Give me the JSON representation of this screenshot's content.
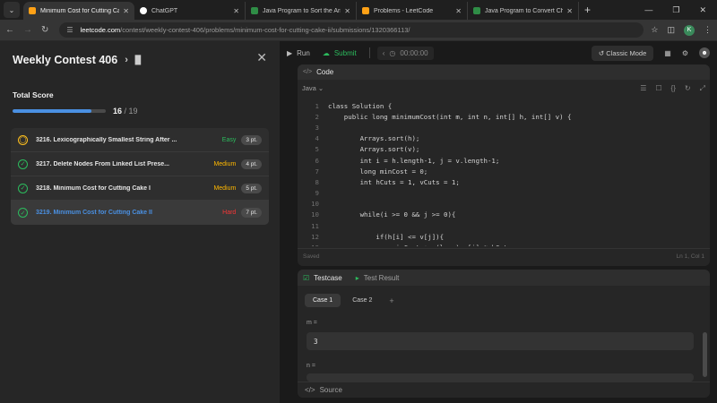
{
  "browser": {
    "tabs": [
      {
        "title": "Minimum Cost for Cutting Cake",
        "active": true,
        "fav_color": "#ffa116"
      },
      {
        "title": "ChatGPT",
        "active": false,
        "fav_color": "#ffffff"
      },
      {
        "title": "Java Program to Sort the Array",
        "active": false,
        "fav_color": "#2f8d46"
      },
      {
        "title": "Problems - LeetCode",
        "active": false,
        "fav_color": "#ffa116"
      },
      {
        "title": "Java Program to Convert Char",
        "active": false,
        "fav_color": "#2f8d46"
      }
    ],
    "url_domain": "leetcode.com",
    "url_path": "/contest/weekly-contest-406/problems/minimum-cost-for-cutting-cake-ii/submissions/1320366113/",
    "avatar_letter": "K"
  },
  "contest": {
    "title": "Weekly Contest 406",
    "score_label": "Total Score",
    "score": "16",
    "score_total": "/ 19",
    "progress": 0.842,
    "problems": [
      {
        "title": "3216. Lexicographically Smallest String After ...",
        "difficulty": "Easy",
        "points": "3 pt.",
        "status": "pending"
      },
      {
        "title": "3217. Delete Nodes From Linked List Prese...",
        "difficulty": "Medium",
        "points": "4 pt.",
        "status": "done"
      },
      {
        "title": "3218. Minimum Cost for Cutting Cake I",
        "difficulty": "Medium",
        "points": "5 pt.",
        "status": "done"
      },
      {
        "title": "3219. Minimum Cost for Cutting Cake II",
        "difficulty": "Hard",
        "points": "7 pt.",
        "status": "done"
      }
    ]
  },
  "toolbar": {
    "run": "Run",
    "submit": "Submit",
    "timer": "00:00:00",
    "classic_mode": "Classic Mode"
  },
  "code_panel": {
    "title": "Code",
    "language": "Java",
    "saved": "Saved",
    "cursor": "Ln 1, Col 1",
    "lines": [
      {
        "n": "1",
        "text": "class Solution {"
      },
      {
        "n": "2",
        "text": "    public long minimumCost(int m, int n, int[] h, int[] v) {"
      },
      {
        "n": "3",
        "text": ""
      },
      {
        "n": "4",
        "text": "        Arrays.sort(h);"
      },
      {
        "n": "5",
        "text": "        Arrays.sort(v);"
      },
      {
        "n": "6",
        "text": "        int i = h.length-1, j = v.length-1;"
      },
      {
        "n": "7",
        "text": "        long minCost = 0;"
      },
      {
        "n": "8",
        "text": "        int hCuts = 1, vCuts = 1;"
      },
      {
        "n": "9",
        "text": ""
      },
      {
        "n": "10",
        "text": ""
      },
      {
        "n": "10",
        "text": "        while(i >= 0 && j >= 0){"
      },
      {
        "n": "11",
        "text": ""
      },
      {
        "n": "12",
        "text": "            if(h[i] <= v[j]){"
      },
      {
        "n": "13",
        "text": "                minCost += (long) v[j] * hCuts;"
      }
    ]
  },
  "test_panel": {
    "tab_testcase": "Testcase",
    "tab_result": "Test Result",
    "case1": "Case 1",
    "case2": "Case 2",
    "add": "+",
    "var1_label": "m =",
    "var1_value": "3",
    "var2_label": "n =",
    "source": "Source"
  }
}
